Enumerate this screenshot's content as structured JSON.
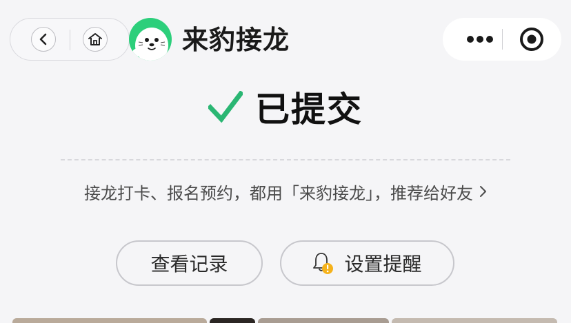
{
  "header": {
    "app_title": "来豹接龙",
    "icons": {
      "back": "chevron-left-icon",
      "home": "home-icon",
      "more": "more-dots-icon",
      "close": "close-circle-icon"
    }
  },
  "status": {
    "text": "已提交",
    "icon": "check-icon",
    "check_color": "#2ab673"
  },
  "promo": {
    "text": "接龙打卡、报名预约，都用「来豹接龙」，推荐给好友",
    "arrow_icon": "chevron-right-icon"
  },
  "actions": {
    "records_label": "查看记录",
    "reminder_label": "设置提醒",
    "reminder_icon": "bell-warning-icon"
  },
  "colors": {
    "brand": "#2ccf7b",
    "background": "#f5f5f7",
    "warning": "#f5b21b"
  }
}
